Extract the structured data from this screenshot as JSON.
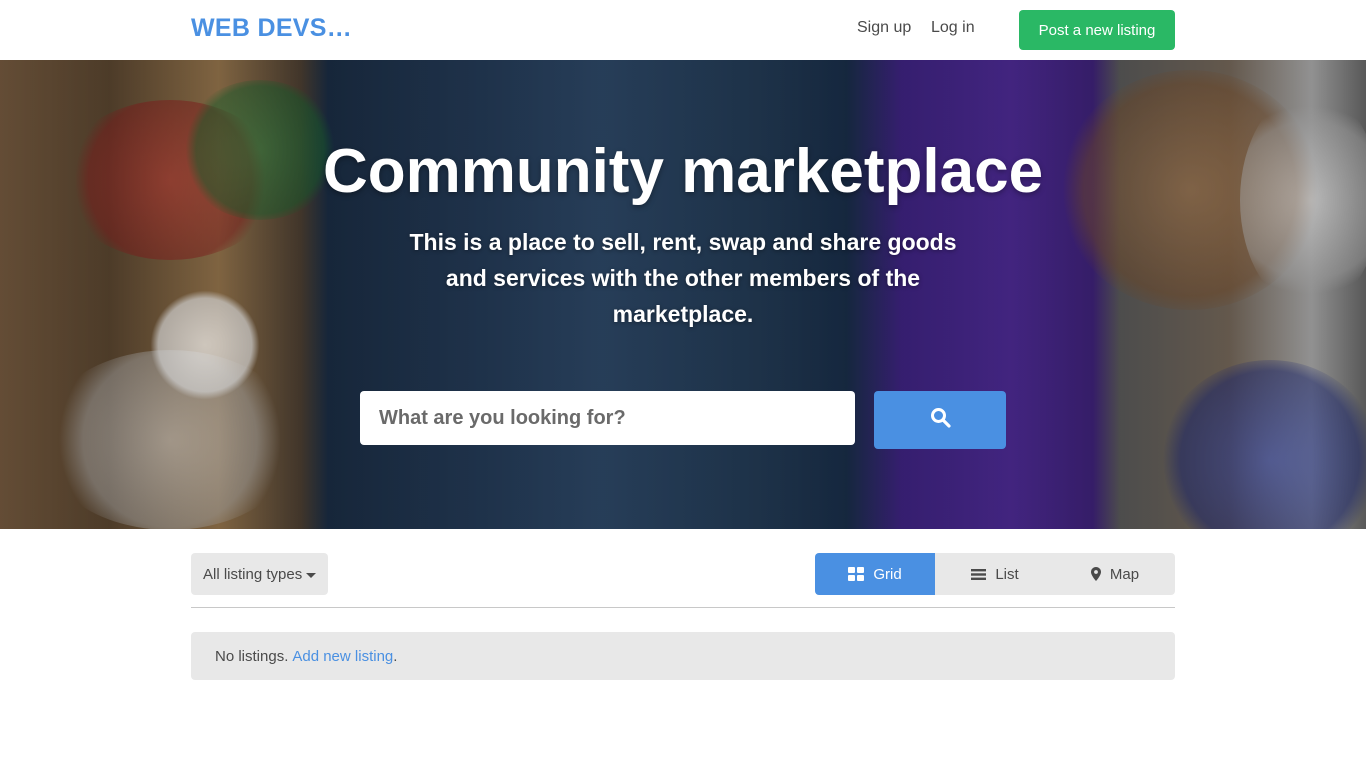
{
  "header": {
    "logo": "WEB DEVS…",
    "signup": "Sign up",
    "login": "Log in",
    "post_listing": "Post a new listing"
  },
  "hero": {
    "title": "Community marketplace",
    "subtitle": "This is a place to sell, rent, swap and share goods and services with the other members of the marketplace.",
    "search_placeholder": "What are you looking for?",
    "search_icon": "search-icon"
  },
  "filters": {
    "listing_type": "All listing types",
    "views": [
      {
        "label": "Grid",
        "icon": "grid-icon",
        "active": true
      },
      {
        "label": "List",
        "icon": "list-icon",
        "active": false
      },
      {
        "label": "Map",
        "icon": "map-marker-icon",
        "active": false
      }
    ]
  },
  "listings": {
    "empty_text": "No listings.",
    "add_link": "Add new listing",
    "add_suffix": "."
  },
  "colors": {
    "brand": "#4a90e2",
    "post_button": "#2ab865",
    "panel": "#e8e8e8"
  }
}
